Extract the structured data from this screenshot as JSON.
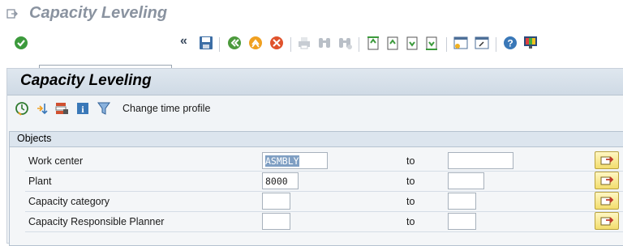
{
  "window": {
    "title": "Capacity Leveling"
  },
  "toolbar": {
    "command_field_value": "",
    "buttons": [
      "enter",
      "save",
      "back",
      "exit",
      "cancel",
      "print",
      "find",
      "find-next",
      "first-page",
      "previous-page",
      "next-page",
      "last-page",
      "create-session",
      "generate-shortcut",
      "help",
      "customize-layout"
    ]
  },
  "screen": {
    "title": "Capacity Leveling",
    "app_toolbar": {
      "change_time_profile_label": "Change time profile"
    }
  },
  "objects": {
    "title": "Objects",
    "to_label": "to",
    "rows": [
      {
        "label": "Work center",
        "from": "ASMBLY",
        "to": ""
      },
      {
        "label": "Plant",
        "from": "8000",
        "to": ""
      },
      {
        "label": "Capacity category",
        "from": "",
        "to": ""
      },
      {
        "label": "Capacity Responsible Planner",
        "from": "",
        "to": ""
      }
    ]
  },
  "colors": {
    "accent": "#2f5f96",
    "panel_header": "#dfe7ef",
    "multi_select_button": "#f2dd6d"
  }
}
